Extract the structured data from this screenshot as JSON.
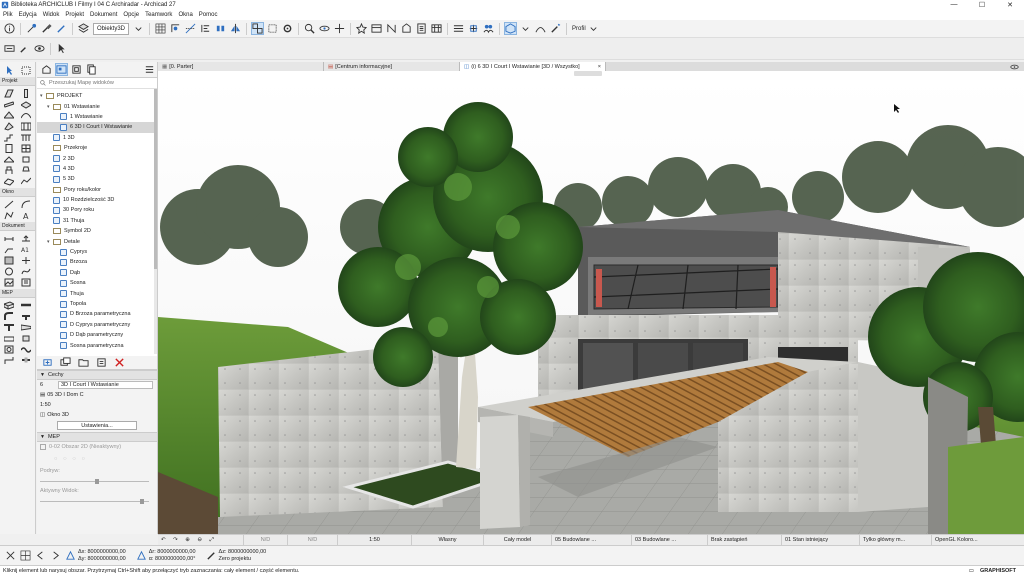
{
  "window": {
    "title": "Biblioteka ARCHICLUB I Filmy I 04 C Archiradar - Archicad 27",
    "controls": [
      "—",
      "☐",
      "✕"
    ]
  },
  "menu": [
    "Plik",
    "Edycja",
    "Widok",
    "Projekt",
    "Dokument",
    "Opcje",
    "Teamwork",
    "Okna",
    "Pomoc"
  ],
  "toolbar": {
    "objects_select": "Obiekty3D",
    "profile_label": "Profil"
  },
  "toolbox": {
    "sections": [
      "Projekt",
      "Okno",
      "Dokument",
      "MEP"
    ]
  },
  "navigator": {
    "search_placeholder": "Przeszukaj Mapę widoków",
    "tree": [
      {
        "label": "PROJEKT",
        "type": "folder",
        "level": 0,
        "expanded": true
      },
      {
        "label": "01 Wstawianie",
        "type": "folder",
        "level": 1,
        "expanded": true
      },
      {
        "label": "1 Wstawianie",
        "type": "view",
        "level": 2
      },
      {
        "label": "6 3D I Court I Wstawianie",
        "type": "view",
        "level": 2,
        "selected": true
      },
      {
        "label": "1 3D",
        "type": "view",
        "level": 1
      },
      {
        "label": "Przekroje",
        "type": "folder",
        "level": 1
      },
      {
        "label": "2 3D",
        "type": "view",
        "level": 1
      },
      {
        "label": "4 3D",
        "type": "view",
        "level": 1
      },
      {
        "label": "5 3D",
        "type": "view",
        "level": 1
      },
      {
        "label": "Pory roku/kolor",
        "type": "folder",
        "level": 1
      },
      {
        "label": "10 Rozdzielczość 3D",
        "type": "view",
        "level": 1
      },
      {
        "label": "30 Pory roku",
        "type": "view",
        "level": 1
      },
      {
        "label": "31 Thuja",
        "type": "view",
        "level": 1
      },
      {
        "label": "Symbol 2D",
        "type": "folder",
        "level": 1
      },
      {
        "label": "Detale",
        "type": "folder",
        "level": 1,
        "expanded": true
      },
      {
        "label": "Cyprys",
        "type": "view",
        "level": 2
      },
      {
        "label": "Brzoza",
        "type": "view",
        "level": 2
      },
      {
        "label": "Dąb",
        "type": "view",
        "level": 2
      },
      {
        "label": "Sosna",
        "type": "view",
        "level": 2
      },
      {
        "label": "Thuja",
        "type": "view",
        "level": 2
      },
      {
        "label": "Topola",
        "type": "view",
        "level": 2
      },
      {
        "label": "D Brzoza parametryczna",
        "type": "view",
        "level": 2
      },
      {
        "label": "D Cyprys parametryczny",
        "type": "view",
        "level": 2
      },
      {
        "label": "D Dąb parametryczny",
        "type": "view",
        "level": 2
      },
      {
        "label": "Sosna parametryczna",
        "type": "view",
        "level": 2
      }
    ]
  },
  "properties": {
    "header": "Cechy",
    "id": "6",
    "name": "3D I Court I Wstawianie",
    "layer": "05 3D I Dom C",
    "scale": "1:50",
    "window3d": "Okno 3D",
    "settings_button": "Ustawienia...",
    "mep_header": "MEP",
    "mep_row": "0-02 Obszar 2D (Nieaktywny)",
    "slider1": "Podryw:",
    "slider2": "Aktywny Widok:"
  },
  "view_tabs": [
    {
      "label": "[0. Parter]",
      "active": false
    },
    {
      "label": "[Centrum informacyjne]",
      "active": false
    },
    {
      "label": "(i) 6 3D I Court I Wstawianie [3D / Wszystko]",
      "active": true,
      "close": "×"
    }
  ],
  "bottom_bar": [
    "N/D",
    "N/D",
    "1:50",
    "Własny",
    "Cały model",
    "05 Budowlane ...",
    "03 Budowlane ...",
    "Brak zastąpień",
    "01 Stan istniejący",
    "Tylko główny m...",
    "OpenGL Koloro..."
  ],
  "coords": {
    "dx": "Δx: 8000000000,00",
    "dy": "Δy: 8000000000,00",
    "ar": "Δr: 8000000000,00",
    "aa": "α: 8000000000,00°",
    "az": "Δz: 8000000000,00",
    "zero": "Zero projektu"
  },
  "status": {
    "message": "Kliknij element lub narysuj obszar. Przytrzymaj Ctrl+Shift aby przełączyć tryb zaznaczania: cały element / część elementu.",
    "brand": "GRAPHISOFT"
  },
  "colors": {
    "accent": "#2f6fc0",
    "concrete": "#c9c9c5",
    "grass": "#5b8c2f",
    "wood": "#b07a3c"
  }
}
